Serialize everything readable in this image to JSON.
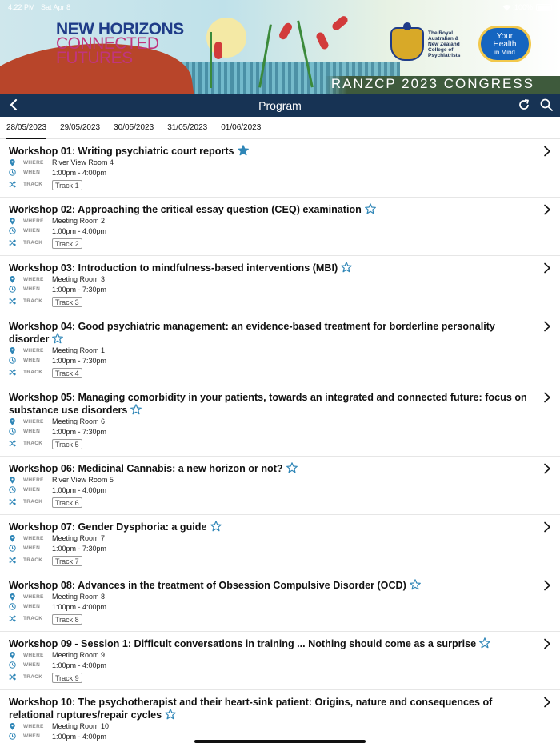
{
  "status_bar": {
    "time": "4:22 PM",
    "date": "Sat Apr 8",
    "battery": "100%"
  },
  "banner": {
    "title_line1": "NEW HORIZONS",
    "title_line2": "CONNECTED",
    "title_line3": "FUTURES",
    "college": "The Royal Australian & New Zealand College of Psychiatrists",
    "your_health_line1": "Your",
    "your_health_line2": "Health",
    "your_health_line3": "in Mind",
    "congress": "RANZCP 2023 CONGRESS"
  },
  "navbar": {
    "title": "Program"
  },
  "tabs": [
    "28/05/2023",
    "29/05/2023",
    "30/05/2023",
    "31/05/2023",
    "01/06/2023"
  ],
  "labels": {
    "where": "WHERE",
    "when": "WHEN",
    "track": "TRACK"
  },
  "accent_color": "#2f86b7",
  "navbar_color": "#173354",
  "workshops": [
    {
      "title": "Workshop 01: Writing psychiatric court reports",
      "starred": true,
      "where": "River View Room 4",
      "when": "1:00pm - 4:00pm",
      "track": "Track 1"
    },
    {
      "title": "Workshop 02: Approaching the critical essay question (CEQ) examination",
      "starred": false,
      "where": "Meeting Room 2",
      "when": "1:00pm - 4:00pm",
      "track": "Track 2"
    },
    {
      "title": "Workshop 03: Introduction to mindfulness-based interventions (MBI)",
      "starred": false,
      "where": "Meeting Room 3",
      "when": "1:00pm - 7:30pm",
      "track": "Track 3"
    },
    {
      "title": "Workshop 04: Good psychiatric management: an evidence-based treatment for borderline personality disorder",
      "starred": false,
      "where": "Meeting Room 1",
      "when": "1:00pm - 7:30pm",
      "track": "Track 4"
    },
    {
      "title": "Workshop 05: Managing comorbidity in your patients, towards an integrated and connected future: focus on substance use disorders",
      "starred": false,
      "where": "Meeting Room 6",
      "when": "1:00pm - 7:30pm",
      "track": "Track 5"
    },
    {
      "title": "Workshop 06: Medicinal Cannabis: a new horizon or not?",
      "starred": false,
      "where": "River View Room 5",
      "when": "1:00pm - 4:00pm",
      "track": "Track 6"
    },
    {
      "title": "Workshop 07: Gender Dysphoria: a guide",
      "starred": false,
      "where": "Meeting Room 7",
      "when": "1:00pm - 7:30pm",
      "track": "Track 7"
    },
    {
      "title": "Workshop 08: Advances in the treatment of Obsession Compulsive Disorder (OCD)",
      "starred": false,
      "where": "Meeting Room 8",
      "when": "1:00pm - 4:00pm",
      "track": "Track 8"
    },
    {
      "title": "Workshop 09 - Session 1: Difficult conversations in training ... Nothing should come as a surprise",
      "starred": false,
      "where": "Meeting Room 9",
      "when": "1:00pm - 4:00pm",
      "track": "Track 9"
    },
    {
      "title": "Workshop 10: The psychotherapist and their heart-sink patient: Origins, nature and consequences of relational ruptures/repair cycles",
      "starred": false,
      "where": "Meeting Room 10",
      "when": "1:00pm - 4:00pm",
      "track": ""
    }
  ]
}
